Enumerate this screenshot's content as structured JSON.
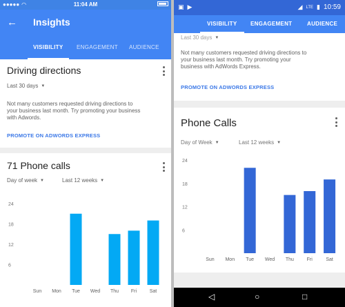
{
  "left": {
    "status": {
      "carrier_icon": "signal-dots-icon",
      "wifi_icon": "wifi-icon",
      "time": "11:04 AM",
      "battery_icon": "battery-icon"
    },
    "appbar": {
      "back_icon": "arrow-left-icon",
      "title": "Insights"
    },
    "tabs": [
      "VISIBILITY",
      "ENGAGEMENT",
      "AUDIENCE"
    ],
    "driving_card": {
      "title": "Driving directions",
      "period": "Last 30 days",
      "desc_lines": [
        "Not many customers requested driving directions to",
        "your business last month. Try promoting your business",
        "with Adwords."
      ],
      "promo": "PROMOTE ON ADWORDS EXPRESS"
    },
    "calls_card": {
      "title": "71 Phone calls",
      "filter_1": "Day of week",
      "filter_2": "Last 12 weeks"
    }
  },
  "right": {
    "status": {
      "icons_left": [
        "image-icon",
        "play-icon"
      ],
      "icons_right": [
        "signal-icon",
        "lte-icon",
        "battery-icon"
      ],
      "time": "10:59"
    },
    "tabs": [
      "VISIBILITY",
      "ENGAGEMENT",
      "AUDIENCE"
    ],
    "driving_card": {
      "period": "Last 30 days",
      "desc_lines": [
        "Not many customers requested driving directions to",
        "your business last month. Try promoting your",
        "business with AdWords Express."
      ],
      "promo": "PROMOTE ON ADWORDS EXPRESS"
    },
    "calls_card": {
      "title": "Phone Calls",
      "filter_1": "Day of Week",
      "filter_2": "Last 12 weeks"
    },
    "nav": {
      "back": "back-triangle-icon",
      "home": "home-circle-icon",
      "recents": "recents-square-icon"
    }
  },
  "chart_data": [
    {
      "type": "bar",
      "categories": [
        "Sun",
        "Mon",
        "Tue",
        "Wed",
        "Thu",
        "Fri",
        "Sat"
      ],
      "values": [
        0,
        0,
        21,
        0,
        15,
        16,
        19
      ],
      "yticks": [
        6,
        12,
        18,
        24
      ],
      "ylim": [
        0,
        24
      ],
      "title": "71 Phone calls",
      "color": "#03a9f4"
    },
    {
      "type": "bar",
      "categories": [
        "Sun",
        "Mon",
        "Tue",
        "Wed",
        "Thu",
        "Fri",
        "Sat"
      ],
      "values": [
        0,
        0,
        22,
        0,
        15,
        16,
        19
      ],
      "yticks": [
        6,
        12,
        18,
        24
      ],
      "ylim": [
        0,
        24
      ],
      "title": "Phone Calls",
      "color": "#3367d6"
    }
  ]
}
